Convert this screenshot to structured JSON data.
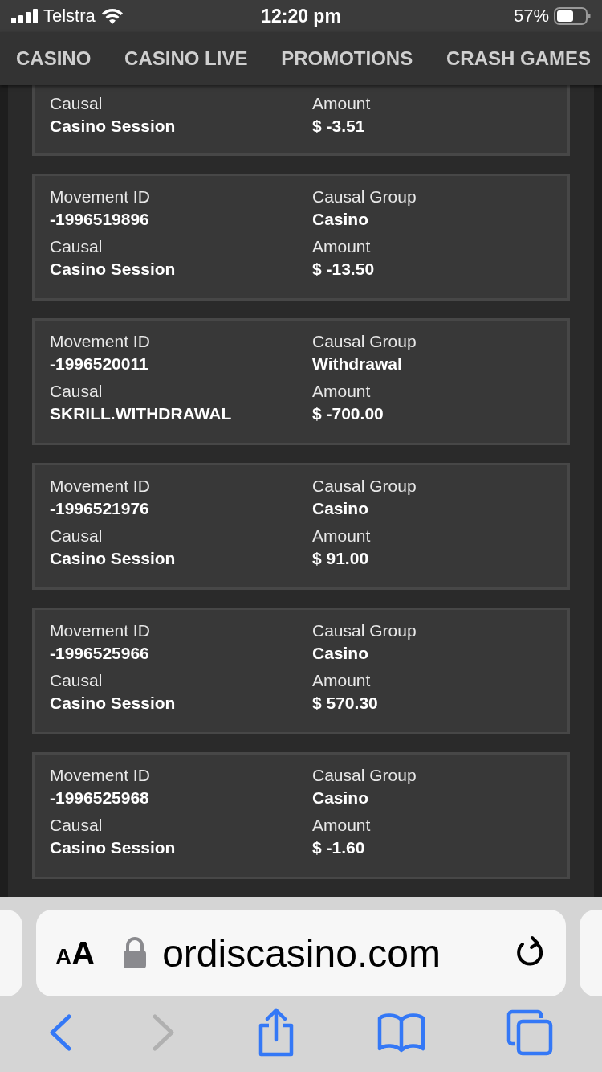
{
  "status_bar": {
    "carrier": "Telstra",
    "time": "12:20 pm",
    "battery": "57%"
  },
  "nav": [
    {
      "label": "CASINO"
    },
    {
      "label": "CASINO LIVE"
    },
    {
      "label": "PROMOTIONS"
    },
    {
      "label": "CRASH GAMES"
    }
  ],
  "cards": [
    {
      "partial": true,
      "fields": [
        {
          "label": "Causal",
          "value": "Casino Session"
        },
        {
          "label": "Amount",
          "value": "$ -3.51"
        }
      ]
    },
    {
      "partial": false,
      "fields": [
        {
          "label": "Movement ID",
          "value": "-1996519896"
        },
        {
          "label": "Causal Group",
          "value": "Casino"
        },
        {
          "label": "Causal",
          "value": "Casino Session"
        },
        {
          "label": "Amount",
          "value": "$ -13.50"
        }
      ]
    },
    {
      "partial": false,
      "fields": [
        {
          "label": "Movement ID",
          "value": "-1996520011"
        },
        {
          "label": "Causal Group",
          "value": "Withdrawal"
        },
        {
          "label": "Causal",
          "value": "SKRILL.WITHDRAWAL"
        },
        {
          "label": "Amount",
          "value": "$ -700.00"
        }
      ]
    },
    {
      "partial": false,
      "fields": [
        {
          "label": "Movement ID",
          "value": "-1996521976"
        },
        {
          "label": "Causal Group",
          "value": "Casino"
        },
        {
          "label": "Causal",
          "value": "Casino Session"
        },
        {
          "label": "Amount",
          "value": "$ 91.00"
        }
      ]
    },
    {
      "partial": false,
      "fields": [
        {
          "label": "Movement ID",
          "value": "-1996525966"
        },
        {
          "label": "Causal Group",
          "value": "Casino"
        },
        {
          "label": "Causal",
          "value": "Casino Session"
        },
        {
          "label": "Amount",
          "value": "$ 570.30"
        }
      ]
    },
    {
      "partial": false,
      "fields": [
        {
          "label": "Movement ID",
          "value": "-1996525968"
        },
        {
          "label": "Causal Group",
          "value": "Casino"
        },
        {
          "label": "Causal",
          "value": "Casino Session"
        },
        {
          "label": "Amount",
          "value": "$ -1.60"
        }
      ]
    }
  ],
  "browser": {
    "text_size_button": "AA",
    "url": "ordiscasino.com"
  }
}
